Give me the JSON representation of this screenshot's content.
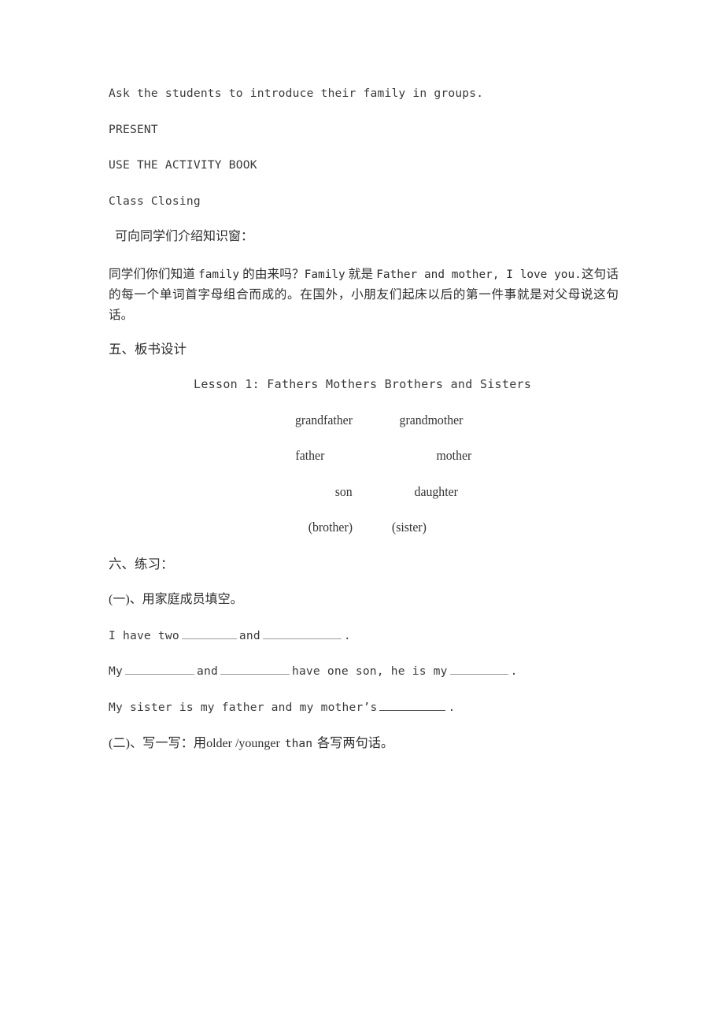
{
  "document": {
    "type": "lesson-plan-page",
    "background_color": "#ffffff",
    "text_color": "#2e2e2e"
  },
  "body": {
    "line_ask": "Ask the students to introduce their family in groups.",
    "line_present": "PRESENT",
    "line_activity_book": "USE THE ACTIVITY BOOK",
    "line_class_closing": "Class Closing",
    "line_knowledge_window": "可向同学们介绍知识窗：",
    "paragraph_cn_part1": "同学们你们知道 ",
    "paragraph_lat1": "family",
    "paragraph_cn_part2": " 的由来吗？",
    "paragraph_lat2": "Family",
    "paragraph_cn_part3": " 就是 ",
    "paragraph_lat3": "Father and mother, I love you.",
    "paragraph_cn_part4": "这句话的每一个单词首字母组合而成的。在国外，小朋友们起床以后的第一件事就是对父母说这句话。"
  },
  "board_design": {
    "heading": "五、板书设计",
    "title": "Lesson 1: Fathers Mothers Brothers and Sisters",
    "tree": [
      {
        "left": "grandfather",
        "right": "grandmother"
      },
      {
        "left": "father",
        "right": "mother"
      },
      {
        "left": "son",
        "right": "daughter"
      },
      {
        "left": "(brother)",
        "right": "(sister)"
      }
    ]
  },
  "exercises": {
    "heading": "六、练习：",
    "part_one_heading": "(一)、用家庭成员填空。",
    "sentence_1": {
      "seg_1": "I have two",
      "blank_1_width": 70,
      "seg_2": "and",
      "blank_2_width": 100,
      "seg_3": "."
    },
    "sentence_2": {
      "seg_1": "My",
      "blank_1_width": 88,
      "seg_2": "and",
      "blank_2_width": 88,
      "seg_3": "have one son, he is my",
      "blank_3_width": 74,
      "seg_4": "."
    },
    "sentence_3": {
      "seg_1": "My sister is my father and my mother’s",
      "blank_1_width": 84,
      "seg_2": "."
    },
    "part_two": {
      "cn_1": "(二)、写一写：用",
      "lat_1": "older /younger",
      "latm_1": "than",
      "cn_2": "各写两句话。"
    }
  }
}
